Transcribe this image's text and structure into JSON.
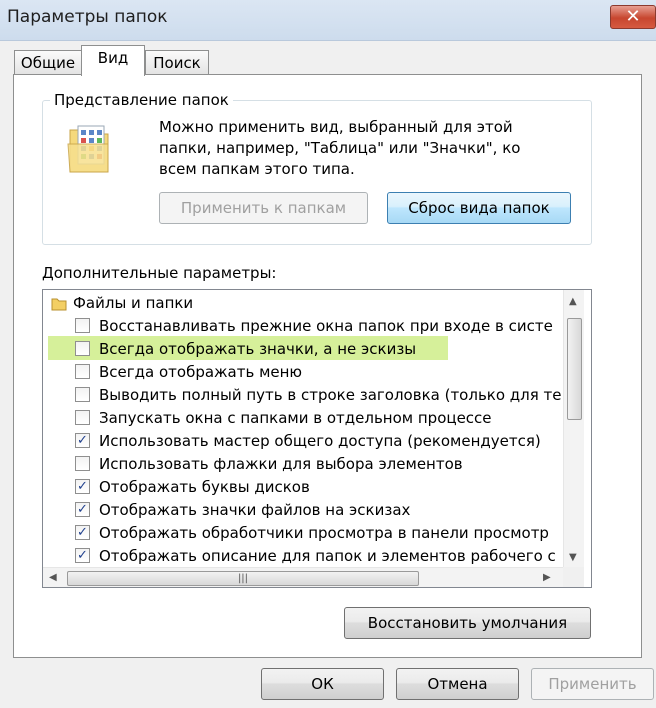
{
  "window": {
    "title": "Параметры папок",
    "close_symbol": "✕"
  },
  "tabs": [
    {
      "label": "Общие",
      "active": false
    },
    {
      "label": "Вид",
      "active": true
    },
    {
      "label": "Поиск",
      "active": false
    }
  ],
  "folder_views": {
    "group_label": "Представление папок",
    "description": "Можно применить вид, выбранный для этой папки, например, \"Таблица\" или \"Значки\", ко всем папкам этого типа.",
    "apply_button": "Применить к папкам",
    "reset_button": "Сброс вида папок",
    "icon": "folder-grid-icon"
  },
  "advanced": {
    "label": "Дополнительные параметры:",
    "root": "Файлы и папки",
    "items": [
      {
        "label": "Восстанавливать прежние окна папок при входе в систе",
        "checked": false
      },
      {
        "label": "Всегда отображать значки, а не эскизы",
        "checked": false,
        "highlighted": true
      },
      {
        "label": "Всегда отображать меню",
        "checked": false
      },
      {
        "label": "Выводить полный путь в строке заголовка (только для те",
        "checked": false
      },
      {
        "label": "Запускать окна с папками в отдельном процессе",
        "checked": false
      },
      {
        "label": "Использовать мастер общего доступа (рекомендуется)",
        "checked": true
      },
      {
        "label": "Использовать флажки для выбора элементов",
        "checked": false
      },
      {
        "label": "Отображать буквы дисков",
        "checked": true
      },
      {
        "label": "Отображать значки файлов на эскизах",
        "checked": true
      },
      {
        "label": "Отображать обработчики просмотра в панели просмотр",
        "checked": true
      },
      {
        "label": "Отображать описание для папок и элементов рабочего с",
        "checked": true
      }
    ],
    "highlight_color": "#d6f09a"
  },
  "restore_button": "Восстановить умолчания",
  "footer": {
    "ok": "ОК",
    "cancel": "Отмена",
    "apply": "Применить"
  }
}
